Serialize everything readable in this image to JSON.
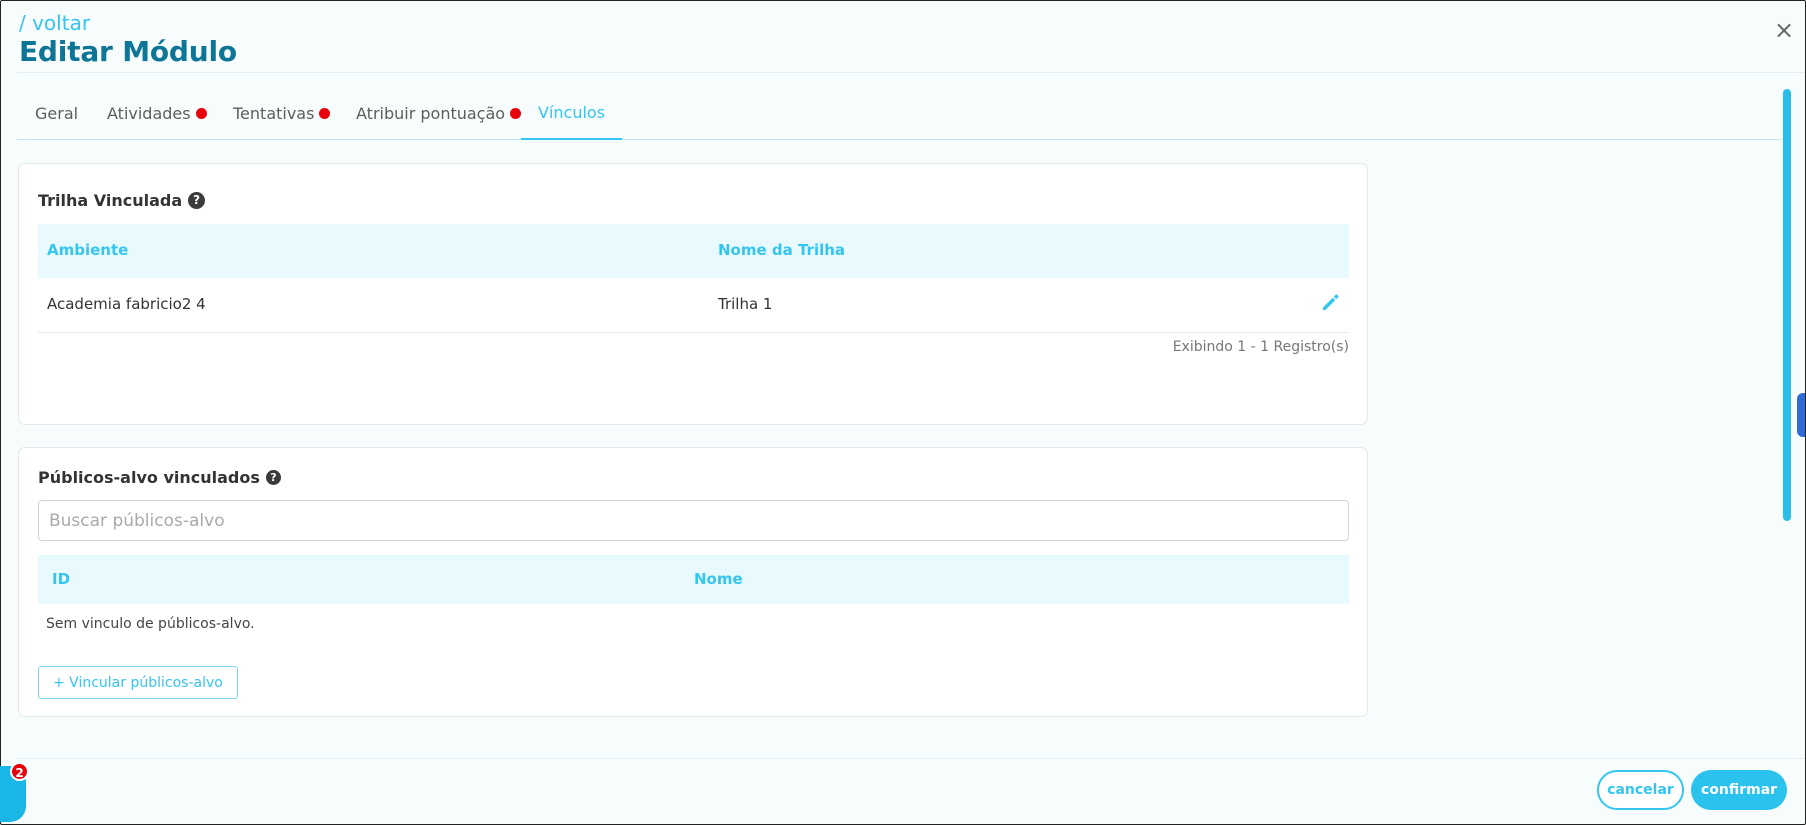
{
  "header": {
    "back_label": "/ voltar",
    "title": "Editar Módulo",
    "close_glyph": "×"
  },
  "tabs": [
    {
      "label": "Geral",
      "alert": false,
      "active": false
    },
    {
      "label": "Atividades",
      "alert": true,
      "active": false
    },
    {
      "label": "Tentativas",
      "alert": true,
      "active": false
    },
    {
      "label": "Atribuir pontuação",
      "alert": true,
      "active": false
    },
    {
      "label": "Vínculos",
      "alert": false,
      "active": true
    }
  ],
  "trilha": {
    "title": "Trilha Vinculada",
    "help_glyph": "?",
    "columns": [
      "Ambiente",
      "Nome da Trilha"
    ],
    "rows": [
      {
        "ambiente": "Academia fabricio2 4",
        "nome": "Trilha 1"
      }
    ],
    "pager": "Exibindo 1 - 1 Registro(s)"
  },
  "publicos": {
    "title": "Públicos-alvo vinculados",
    "help_glyph": "?",
    "search_placeholder": "Buscar públicos-alvo",
    "search_value": "",
    "columns": [
      "ID",
      "Nome"
    ],
    "empty_message": "Sem vinculo de públicos-alvo.",
    "link_button": "+ Vincular públicos-alvo"
  },
  "footer": {
    "cancel_label": "cancelar",
    "confirm_label": "confirmar"
  },
  "chat": {
    "badge_count": "2"
  },
  "colors": {
    "accent": "#35c5ee",
    "title": "#0d7595",
    "alert_dot": "#e8000b",
    "table_header_bg": "#e9fafe"
  },
  "icons": [
    "close-icon",
    "help-icon",
    "edit-pencil-icon",
    "chat-icon"
  ]
}
